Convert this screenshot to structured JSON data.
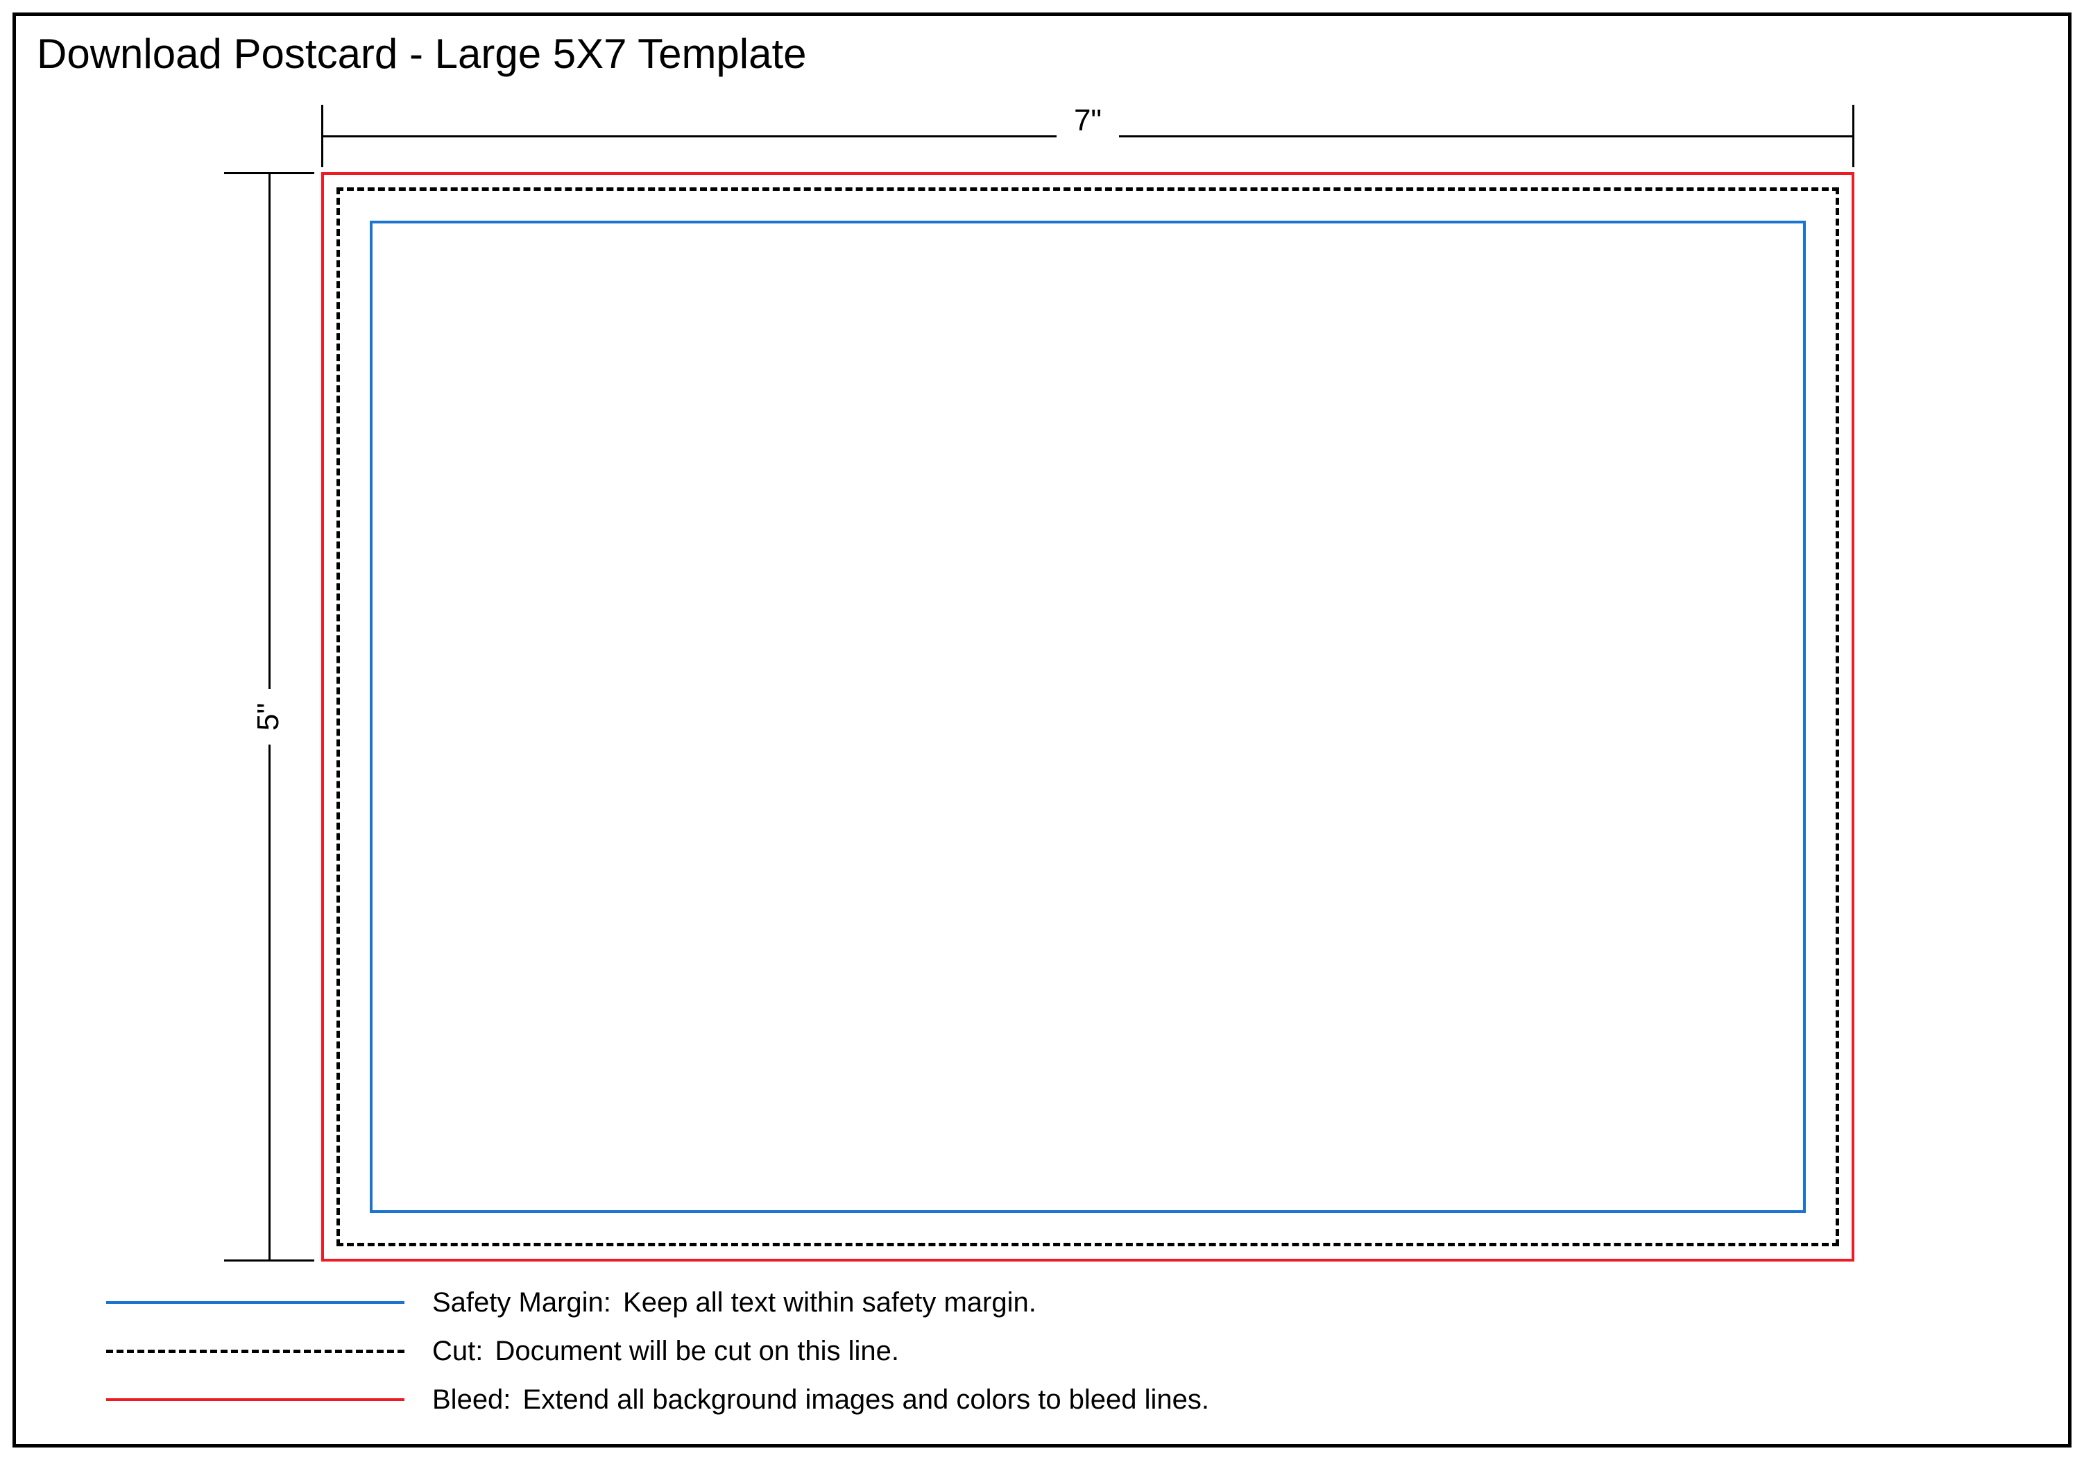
{
  "title": "Download Postcard - Large 5X7 Template",
  "dims": {
    "width_label": "7\"",
    "height_label": "5\""
  },
  "legend": {
    "safety": {
      "label": "Safety Margin:",
      "desc": "Keep all text within safety margin."
    },
    "cut": {
      "label": "Cut:",
      "desc": "Document will be cut on this line."
    },
    "bleed": {
      "label": "Bleed:",
      "desc": "Extend all background images and colors to bleed lines."
    }
  },
  "colors": {
    "bleed": "#ec1c24",
    "cut": "#000000",
    "safety": "#1b75d0"
  }
}
